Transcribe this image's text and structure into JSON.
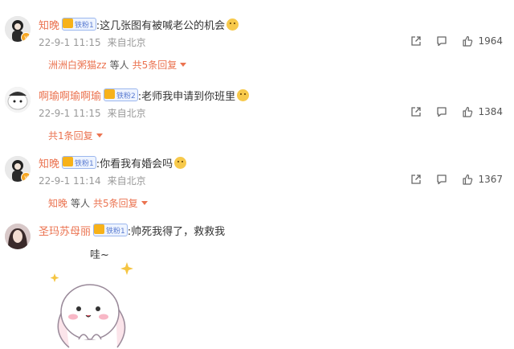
{
  "comments": [
    {
      "username": "知晚",
      "badge": "铁粉1",
      "text": ":这几张图有被喊老公的机会",
      "date": "22-9-1 11:15",
      "source": "来自北京",
      "likes": "1964",
      "reply": {
        "names": "洲洲白粥猫zz",
        "suffix": "等人",
        "count": "共5条回复"
      }
    },
    {
      "username": "啊瑜啊瑜啊瑜",
      "badge": "铁粉2",
      "text": ":老师我申请到你班里",
      "date": "22-9-1 11:15",
      "source": "来自北京",
      "likes": "1384",
      "reply": {
        "count": "共1条回复"
      }
    },
    {
      "username": "知晚",
      "badge": "铁粉1",
      "text": ":你看我有婚会吗",
      "date": "22-9-1 11:14",
      "source": "来自北京",
      "likes": "1367",
      "reply": {
        "names": "知晚",
        "suffix": "等人",
        "count": "共5条回复"
      }
    },
    {
      "username": "圣玛苏母丽",
      "badge": "铁粉1",
      "text": ":帅死我得了，救救我",
      "sticker_text": "哇~"
    }
  ],
  "colors": {
    "name": "#eb7350",
    "meta": "#999999",
    "badge": "#5a7bd0"
  },
  "icons": [
    "share-icon",
    "comment-icon",
    "like-icon"
  ]
}
